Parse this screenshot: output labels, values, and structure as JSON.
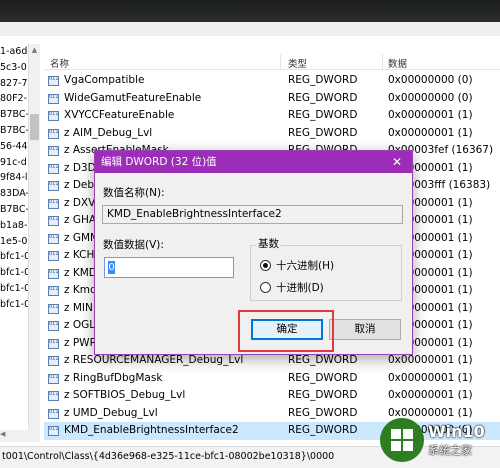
{
  "tree": {
    "items": [
      "1-a6d-l",
      "5c3-0",
      "827-7(",
      "80F2-",
      "B7BC-",
      "B7BC-",
      "56-44",
      "91c-d",
      "9f84-l",
      "83DA-",
      "B7BC-",
      "b1a8-",
      "1e5-0",
      "bfc1-0",
      "bfc1-0",
      "bfc1-0",
      "bfc1-0"
    ]
  },
  "list": {
    "headers": {
      "name": "名称",
      "type": "类型",
      "data": "数据"
    },
    "rows": [
      {
        "name": "VgaCompatible",
        "type": "REG_DWORD",
        "data": "0x00000000 (0)"
      },
      {
        "name": "WideGamutFeatureEnable",
        "type": "REG_DWORD",
        "data": "0x00000000 (0)"
      },
      {
        "name": "XVYCCFeatureEnable",
        "type": "REG_DWORD",
        "data": "0x00000001 (1)"
      },
      {
        "name": "z AIM_Debug_Lvl",
        "type": "REG_DWORD",
        "data": "0x00000001 (1)"
      },
      {
        "name": "z AssertEnableMask",
        "type": "REG_DWORD",
        "data": "0x00003fef (16367)"
      },
      {
        "name": "z D3D",
        "type": "REG_DWORD",
        "data": "0x00000001 (1)"
      },
      {
        "name": "z Debu",
        "type": "REG_DWORD",
        "data": "0x00003fff (16383)"
      },
      {
        "name": "z DXV",
        "type": "REG_DWORD",
        "data": "0x00000001 (1)"
      },
      {
        "name": "z GHA",
        "type": "REG_DWORD",
        "data": "0x00000001 (1)"
      },
      {
        "name": "z GMM",
        "type": "REG_DWORD",
        "data": "0x00000001 (1)"
      },
      {
        "name": "z KCH",
        "type": "REG_DWORD",
        "data": "0x00000001 (1)"
      },
      {
        "name": "z KMD",
        "type": "REG_DWORD",
        "data": "0x00000001 (1)"
      },
      {
        "name": "z Kmd",
        "type": "REG_DWORD",
        "data": "0x00000001 (1)"
      },
      {
        "name": "z MIN",
        "type": "REG_DWORD",
        "data": "0x00000001 (1)"
      },
      {
        "name": "z OGL",
        "type": "REG_DWORD",
        "data": "0x00000001 (1)"
      },
      {
        "name": "z PWR",
        "type": "REG_DWORD",
        "data": "0x00000001 (1)"
      },
      {
        "name": "z RESOURCEMANAGER_Debug_Lvl",
        "type": "REG_DWORD",
        "data": "0x00000001 (1)"
      },
      {
        "name": "z RingBufDbgMask",
        "type": "REG_DWORD",
        "data": "0x00000001 (1)"
      },
      {
        "name": "z SOFTBIOS_Debug_Lvl",
        "type": "REG_DWORD",
        "data": "0x00000001 (1)"
      },
      {
        "name": "z UMD_Debug_Lvl",
        "type": "REG_DWORD",
        "data": "0x00000001 (1)"
      },
      {
        "name": "KMD_EnableBrightnessInterface2",
        "type": "REG_DWORD",
        "data": "0x00000000 (0)"
      }
    ],
    "selected_row": "KMD_EnableBrightnessInterface2"
  },
  "status_bar": {
    "path": "t001\\Control\\Class\\{4d36e968-e325-11ce-bfc1-08002be10318}\\0000"
  },
  "dialog": {
    "title": "编辑 DWORD (32 位)值",
    "close": "✕",
    "name_label": "数值名称(N):",
    "name_value": "KMD_EnableBrightnessInterface2",
    "data_label": "数值数据(V):",
    "data_value": "0",
    "base_label": "基数",
    "radio_hex": "十六进制(H)",
    "radio_dec": "十进制(D)",
    "base_selected": "hex",
    "ok": "确定",
    "cancel": "取消"
  },
  "watermark": {
    "title": "Win10",
    "subtitle": "系统之家",
    "brand_color": "#2e7d20"
  }
}
